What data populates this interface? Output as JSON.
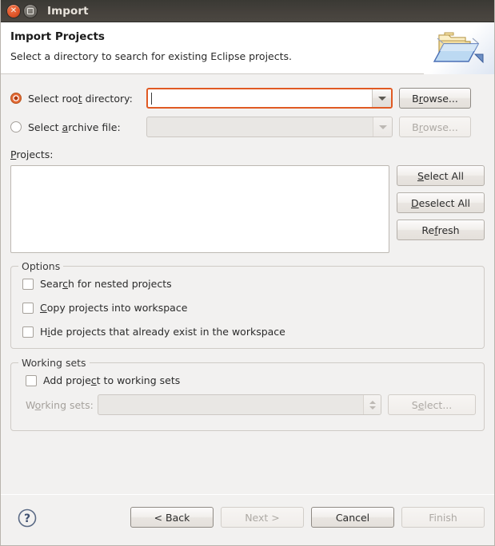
{
  "window": {
    "title": "Import",
    "close_icon": "close-icon",
    "maximize_icon": "maximize-icon"
  },
  "header": {
    "title": "Import Projects",
    "description": "Select a directory to search for existing Eclipse projects.",
    "icon": "import-folder-icon"
  },
  "source": {
    "root_directory": {
      "radio_label_pre": "Select roo",
      "radio_label_mnemonic": "t",
      "radio_label_post": " directory:",
      "label_full": "Select root directory:",
      "selected": true,
      "value": "",
      "browse_pre": "B",
      "browse_mnemonic": "r",
      "browse_post": "owse...",
      "browse_label": "Browse...",
      "enabled": true
    },
    "archive_file": {
      "radio_label_pre": "Select ",
      "radio_label_mnemonic": "a",
      "radio_label_post": "rchive file:",
      "label_full": "Select archive file:",
      "selected": false,
      "value": "",
      "browse_pre": "B",
      "browse_mnemonic": "r",
      "browse_post": "owse...",
      "browse_label": "Browse...",
      "enabled": false
    }
  },
  "projects": {
    "label_pre": "",
    "label_mnemonic": "P",
    "label_post": "rojects:",
    "label_full": "Projects:",
    "items": [],
    "buttons": [
      {
        "pre": "",
        "mnemonic": "S",
        "post": "elect All",
        "label": "Select All",
        "name": "select-all-button",
        "enabled": true
      },
      {
        "pre": "",
        "mnemonic": "D",
        "post": "eselect All",
        "label": "Deselect All",
        "name": "deselect-all-button",
        "enabled": true
      },
      {
        "pre": "Re",
        "mnemonic": "f",
        "post": "resh",
        "label": "Refresh",
        "name": "refresh-button",
        "enabled": true
      }
    ]
  },
  "options": {
    "group_title": "Options",
    "items": [
      {
        "pre": "Sear",
        "mnemonic": "c",
        "post": "h for nested projects",
        "label": "Search for nested projects",
        "checked": false,
        "name": "checkbox-search-nested-projects"
      },
      {
        "pre": "",
        "mnemonic": "C",
        "post": "opy projects into workspace",
        "label": "Copy projects into workspace",
        "checked": false,
        "name": "checkbox-copy-projects-into-workspace"
      },
      {
        "pre": "H",
        "mnemonic": "i",
        "post": "de projects that already exist in the workspace",
        "label": "Hide projects that already exist in the workspace",
        "checked": false,
        "name": "checkbox-hide-existing-projects"
      }
    ]
  },
  "working_sets": {
    "group_title": "Working sets",
    "add_checkbox": {
      "pre": "Add proje",
      "mnemonic": "c",
      "post": "t to working sets",
      "label": "Add project to working sets",
      "checked": false
    },
    "field_label_pre": "W",
    "field_label_mnemonic": "o",
    "field_label_post": "rking sets:",
    "field_label_full": "Working sets:",
    "field_value": "",
    "field_enabled": false,
    "select_button": {
      "pre": "S",
      "mnemonic": "e",
      "post": "lect...",
      "label": "Select...",
      "enabled": false
    }
  },
  "footer": {
    "help_icon": "help-icon",
    "buttons": [
      {
        "label": "< Back",
        "name": "back-button",
        "enabled": true
      },
      {
        "label": "Next >",
        "name": "next-button",
        "enabled": false
      },
      {
        "label": "Cancel",
        "name": "cancel-button",
        "enabled": true
      },
      {
        "label": "Finish",
        "name": "finish-button",
        "enabled": false
      }
    ]
  },
  "colors": {
    "accent": "#e05a23",
    "dialog_bg": "#f2f1f0",
    "titlebar": "#45413c",
    "close_button": "#e0562a"
  }
}
